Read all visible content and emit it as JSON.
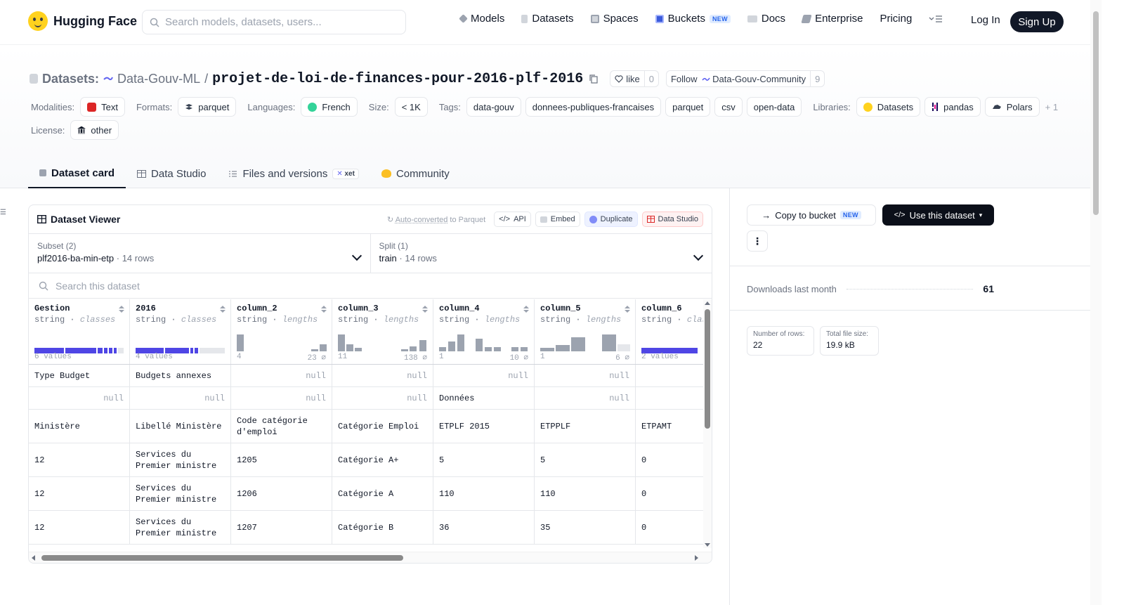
{
  "nav": {
    "brand": "Hugging Face",
    "search_placeholder": "Search models, datasets, users...",
    "links": [
      "Models",
      "Datasets",
      "Spaces",
      "Buckets",
      "Docs",
      "Enterprise",
      "Pricing"
    ],
    "buckets_badge": "NEW",
    "login": "Log In",
    "signup": "Sign Up"
  },
  "header": {
    "prefix": "Datasets:",
    "org": "Data-Gouv-ML",
    "slash": "/",
    "name": "projet-de-loi-de-finances-pour-2016-plf-2016",
    "like_label": "like",
    "like_count": "0",
    "follow_label": "Follow",
    "follow_org": "Data-Gouv-Community",
    "follow_count": "9"
  },
  "tags": {
    "modalities_label": "Modalities:",
    "modalities": [
      "Text"
    ],
    "formats_label": "Formats:",
    "formats": [
      "parquet"
    ],
    "languages_label": "Languages:",
    "languages": [
      "French"
    ],
    "size_label": "Size:",
    "size": "< 1K",
    "tags_label": "Tags:",
    "tags": [
      "data-gouv",
      "donnees-publiques-francaises",
      "parquet",
      "csv",
      "open-data"
    ],
    "libraries_label": "Libraries:",
    "libraries": [
      "Datasets",
      "pandas",
      "Polars"
    ],
    "libraries_more": "+ 1",
    "license_label": "License:",
    "license": "other"
  },
  "tabs": [
    "Dataset card",
    "Data Studio",
    "Files and versions",
    "Community"
  ],
  "xet_badge": "xet",
  "viewer": {
    "title": "Dataset Viewer",
    "auto_converted": "Auto-converted",
    "auto_suffix": " to Parquet",
    "buttons": [
      "API",
      "Embed",
      "Duplicate",
      "Data Studio"
    ],
    "subset_label": "Subset (2)",
    "subset_value": "plf2016-ba-min-etp",
    "subset_rows": "14 rows",
    "split_label": "Split (1)",
    "split_value": "train",
    "split_rows": "14 rows",
    "search_placeholder": "Search this dataset",
    "columns": [
      {
        "name": "Gestion",
        "type": "string",
        "kind": "classes",
        "left": "6 values",
        "right": ""
      },
      {
        "name": "2016",
        "type": "string",
        "kind": "classes",
        "left": "4 values",
        "right": ""
      },
      {
        "name": "column_2",
        "type": "string",
        "kind": "lengths",
        "left": "4",
        "right": "23 ⌀"
      },
      {
        "name": "column_3",
        "type": "string",
        "kind": "lengths",
        "left": "11",
        "right": "138 ⌀"
      },
      {
        "name": "column_4",
        "type": "string",
        "kind": "lengths",
        "left": "1",
        "right": "10 ⌀"
      },
      {
        "name": "column_5",
        "type": "string",
        "kind": "lengths",
        "left": "1",
        "right": "6 ⌀"
      },
      {
        "name": "column_6",
        "type": "string",
        "kind": "classes",
        "left": "2 values",
        "right": ""
      }
    ],
    "null_text": "null",
    "rows": [
      [
        "Type Budget",
        "Budgets annexes",
        null,
        null,
        null,
        null,
        ""
      ],
      [
        null,
        null,
        null,
        null,
        "Données",
        null,
        ""
      ],
      [
        "Ministère",
        "Libellé Ministère",
        "Code catégorie d'emploi",
        "Catégorie Emploi",
        "ETPLF 2015",
        "ETPPLF",
        "ETPAMT"
      ],
      [
        "12",
        "Services du Premier ministre",
        "1205",
        "Catégorie A+",
        "5",
        "5",
        "0"
      ],
      [
        "12",
        "Services du Premier ministre",
        "1206",
        "Catégorie A",
        "110",
        "110",
        "0"
      ],
      [
        "12",
        "Services du Premier ministre",
        "1207",
        "Catégorie B",
        "36",
        "35",
        "0"
      ]
    ]
  },
  "sidebar": {
    "copy_bucket": "Copy to bucket",
    "copy_badge": "NEW",
    "use_dataset": "Use this dataset",
    "more": "⋮",
    "downloads_label": "Downloads last month",
    "downloads_value": "61",
    "rows_label": "Number of rows:",
    "rows_value": "22",
    "size_label": "Total file size:",
    "size_value": "19.9 kB"
  },
  "colors": {
    "accent": "#4f46e5",
    "dark": "#0b0f19",
    "brand": "#ffd21e"
  }
}
